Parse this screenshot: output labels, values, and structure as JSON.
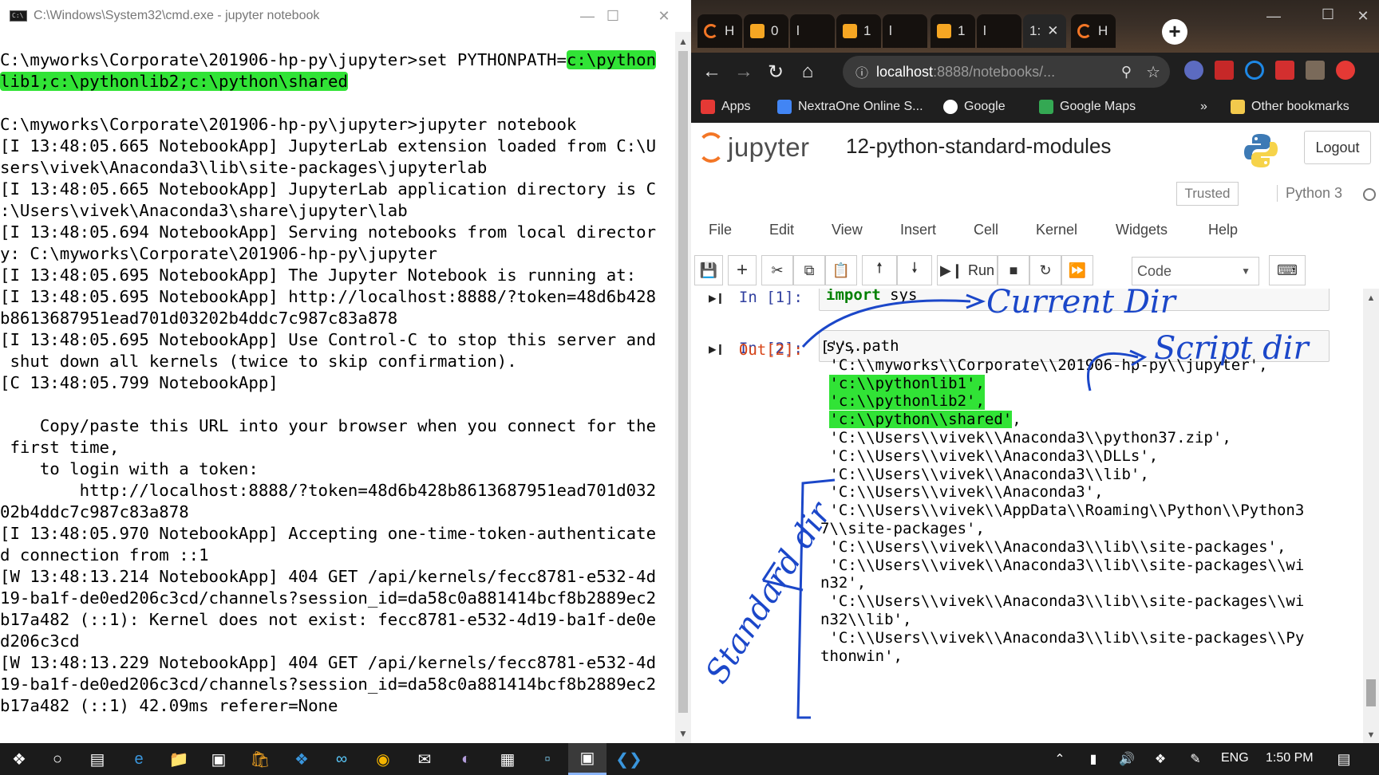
{
  "cmd": {
    "title": "C:\\Windows\\System32\\cmd.exe - jupyter  notebook",
    "lines": [
      {
        "text": "C:\\myworks\\Corporate\\201906-hp-py\\jupyter>set PYTHONPATH=",
        "hl": "c:\\python"
      },
      {
        "text": "",
        "hl": "lib1;c:\\pythonlib2;c:\\python\\shared"
      },
      {
        "text": ""
      },
      {
        "text": "C:\\myworks\\Corporate\\201906-hp-py\\jupyter>jupyter notebook"
      },
      {
        "text": "[I 13:48:05.665 NotebookApp] JupyterLab extension loaded from C:\\U"
      },
      {
        "text": "sers\\vivek\\Anaconda3\\lib\\site-packages\\jupyterlab"
      },
      {
        "text": "[I 13:48:05.665 NotebookApp] JupyterLab application directory is C"
      },
      {
        "text": ":\\Users\\vivek\\Anaconda3\\share\\jupyter\\lab"
      },
      {
        "text": "[I 13:48:05.694 NotebookApp] Serving notebooks from local director"
      },
      {
        "text": "y: C:\\myworks\\Corporate\\201906-hp-py\\jupyter"
      },
      {
        "text": "[I 13:48:05.695 NotebookApp] The Jupyter Notebook is running at:"
      },
      {
        "text": "[I 13:48:05.695 NotebookApp] http://localhost:8888/?token=48d6b428"
      },
      {
        "text": "b8613687951ead701d03202b4ddc7c987c83a878"
      },
      {
        "text": "[I 13:48:05.695 NotebookApp] Use Control-C to stop this server and"
      },
      {
        "text": " shut down all kernels (twice to skip confirmation)."
      },
      {
        "text": "[C 13:48:05.799 NotebookApp]"
      },
      {
        "text": ""
      },
      {
        "text": "    Copy/paste this URL into your browser when you connect for the"
      },
      {
        "text": " first time,"
      },
      {
        "text": "    to login with a token:"
      },
      {
        "text": "        http://localhost:8888/?token=48d6b428b8613687951ead701d032"
      },
      {
        "text": "02b4ddc7c987c83a878"
      },
      {
        "text": "[I 13:48:05.970 NotebookApp] Accepting one-time-token-authenticate"
      },
      {
        "text": "d connection from ::1"
      },
      {
        "text": "[W 13:48:13.214 NotebookApp] 404 GET /api/kernels/fecc8781-e532-4d"
      },
      {
        "text": "19-ba1f-de0ed206c3cd/channels?session_id=da58c0a881414bcf8b2889ec2"
      },
      {
        "text": "b17a482 (::1): Kernel does not exist: fecc8781-e532-4d19-ba1f-de0e"
      },
      {
        "text": "d206c3cd"
      },
      {
        "text": "[W 13:48:13.229 NotebookApp] 404 GET /api/kernels/fecc8781-e532-4d"
      },
      {
        "text": "19-ba1f-de0ed206c3cd/channels?session_id=da58c0a881414bcf8b2889ec2"
      },
      {
        "text": "b17a482 (::1) 42.09ms referer=None"
      }
    ]
  },
  "chrome": {
    "tabs": [
      {
        "label": "H",
        "icon": "jupyter-icon"
      },
      {
        "label": "0",
        "icon": "notebook-icon"
      },
      {
        "label": "l",
        "icon": ""
      },
      {
        "label": "1",
        "icon": "notebook-icon"
      },
      {
        "label": "l",
        "icon": ""
      },
      {
        "label": "1",
        "icon": "notebook-icon"
      },
      {
        "label": "l",
        "icon": ""
      },
      {
        "label": "1:",
        "icon": "",
        "close": "✕"
      },
      {
        "label": "H",
        "icon": "jupyter-icon"
      }
    ],
    "new_tab": "+",
    "url_host": "localhost",
    "url_rest": ":8888/notebooks/...",
    "bookmarks": [
      {
        "label": "Apps",
        "icon": "apps-icon"
      },
      {
        "label": "NextraOne Online S...",
        "icon": "nextraone-icon"
      },
      {
        "label": "Google",
        "icon": "google-icon"
      },
      {
        "label": "Google Maps",
        "icon": "maps-icon"
      }
    ],
    "more": "»",
    "other_bookmarks": "Other bookmarks"
  },
  "jupyter": {
    "logo_text": "jupyter",
    "notebook_name": "12-python-standard-modules",
    "logout": "Logout",
    "trusted": "Trusted",
    "kernel": "Python 3",
    "menu": [
      "File",
      "Edit",
      "View",
      "Insert",
      "Cell",
      "Kernel",
      "Widgets",
      "Help"
    ],
    "toolbar": {
      "run_label": "Run",
      "cell_type": "Code"
    },
    "cells": [
      {
        "prompt": "In [1]:",
        "kw": "import",
        "code": " sys"
      },
      {
        "prompt": "In [2]:",
        "kw": "",
        "code": "sys.path"
      }
    ],
    "out_prompt": "Out[2]:",
    "output": [
      {
        "text": "['',"
      },
      {
        "text": " 'C:\\\\myworks\\\\Corporate\\\\201906-hp-py\\\\jupyter',"
      },
      {
        "text": " ",
        "hl": "'c:\\\\pythonlib1',"
      },
      {
        "text": " ",
        "hl": "'c:\\\\pythonlib2',"
      },
      {
        "text": " ",
        "hl": "'c:\\\\python\\\\shared'",
        "after": ","
      },
      {
        "text": " 'C:\\\\Users\\\\vivek\\\\Anaconda3\\\\python37.zip',"
      },
      {
        "text": " 'C:\\\\Users\\\\vivek\\\\Anaconda3\\\\DLLs',"
      },
      {
        "text": " 'C:\\\\Users\\\\vivek\\\\Anaconda3\\\\lib',"
      },
      {
        "text": " 'C:\\\\Users\\\\vivek\\\\Anaconda3',"
      },
      {
        "text": " 'C:\\\\Users\\\\vivek\\\\AppData\\\\Roaming\\\\Python\\\\Python3"
      },
      {
        "text": "7\\\\site-packages',"
      },
      {
        "text": " 'C:\\\\Users\\\\vivek\\\\Anaconda3\\\\lib\\\\site-packages',"
      },
      {
        "text": " 'C:\\\\Users\\\\vivek\\\\Anaconda3\\\\lib\\\\site-packages\\\\wi"
      },
      {
        "text": "n32',"
      },
      {
        "text": " 'C:\\\\Users\\\\vivek\\\\Anaconda3\\\\lib\\\\site-packages\\\\wi"
      },
      {
        "text": "n32\\\\lib',"
      },
      {
        "text": " 'C:\\\\Users\\\\vivek\\\\Anaconda3\\\\lib\\\\site-packages\\\\Py"
      },
      {
        "text": "thonwin',"
      }
    ]
  },
  "annotations": {
    "current_dir": "Current Dir",
    "script_dir": "Script dir",
    "standard_dir": "Standard dir",
    "ink_color": "#1b47c9"
  },
  "taskbar": {
    "language": "ENG",
    "time": "1:50 PM"
  },
  "colors": {
    "highlight": "#31e336",
    "jupyter_orange": "#f37626",
    "prompt_in": "#303f9f",
    "prompt_out": "#d84315"
  }
}
